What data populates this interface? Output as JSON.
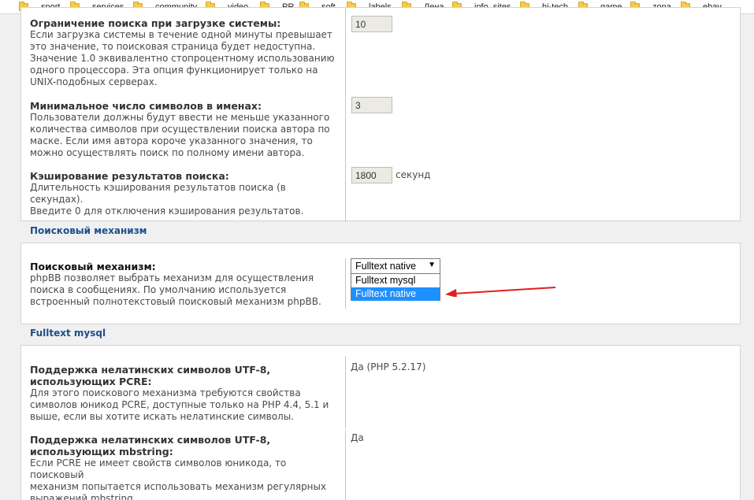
{
  "bookmarks": [
    {
      "label": "sport"
    },
    {
      "label": "services"
    },
    {
      "label": "community"
    },
    {
      "label": "video"
    },
    {
      "label": "PR"
    },
    {
      "label": "soft"
    },
    {
      "label": "labels"
    },
    {
      "label": "Лена"
    },
    {
      "label": "info_sites"
    },
    {
      "label": "hi-tech"
    },
    {
      "label": "game"
    },
    {
      "label": "zona"
    },
    {
      "label": "ebay"
    }
  ],
  "search_settings": {
    "load_limit": {
      "title": "Ограничение поиска при загрузке системы:",
      "lines": [
        "Если загрузка системы в течение одной минуты превышает",
        "это значение, то поисковая страница будет недоступна.",
        "Значение 1.0 эквивалентно стопроцентному использованию",
        "одного процессора. Эта опция функционирует только на",
        "UNIX-подобных серверах."
      ],
      "value": "10"
    },
    "min_author_chars": {
      "title": "Минимальное число символов в именах:",
      "lines": [
        "Пользователи должны будут ввести не меньше указанного",
        "количества символов при осуществлении поиска автора по",
        "маске. Если имя автора короче указанного значения, то",
        "можно осуществлять поиск по полному имени автора."
      ],
      "value": "3"
    },
    "cache": {
      "title": "Кэширование результатов поиска:",
      "lines": [
        "Длительность кэширования результатов поиска (в секундах).",
        "Введите 0 для отключения кэширования результатов."
      ],
      "value": "1800",
      "unit": "секунд"
    }
  },
  "search_backend": {
    "section_title": "Поисковый механизм",
    "title": "Поисковый механизм:",
    "lines": [
      "phpBB позволяет выбрать механизм для осуществления",
      "поиска в сообщениях. По умолчанию используется",
      "встроенный полнотекстовый поисковый механизм phpBB."
    ],
    "selected": "Fulltext native",
    "options": [
      "Fulltext mysql",
      "Fulltext native"
    ],
    "highlighted_option": "Fulltext native",
    "arrow_color": "#e02020"
  },
  "fulltext_mysql": {
    "section_title": "Fulltext mysql",
    "pcre": {
      "title_lines": [
        "Поддержка нелатинских символов UTF-8,",
        "использующих PCRE:"
      ],
      "lines": [
        "Для этого поискового механизма требуются свойства",
        "символов юникод PCRE, доступные только на PHP 4.4, 5.1 и",
        "выше, если вы хотите искать нелатинские символы."
      ],
      "value": "Да (PHP 5.2.17)"
    },
    "mbstring": {
      "title_lines": [
        "Поддержка нелатинских символов UTF-8,",
        "использующих mbstring:"
      ],
      "lines": [
        "Если PCRE не имеет свойств символов юникода, то поисковый",
        "механизм попытается использовать механизм регулярных",
        "выражений mbstring."
      ],
      "value": "Да"
    }
  },
  "colors": {
    "link_blue": "#1d4f8a",
    "selection_blue": "#1e90ff",
    "folder_yellow": "#f4cc4f"
  }
}
